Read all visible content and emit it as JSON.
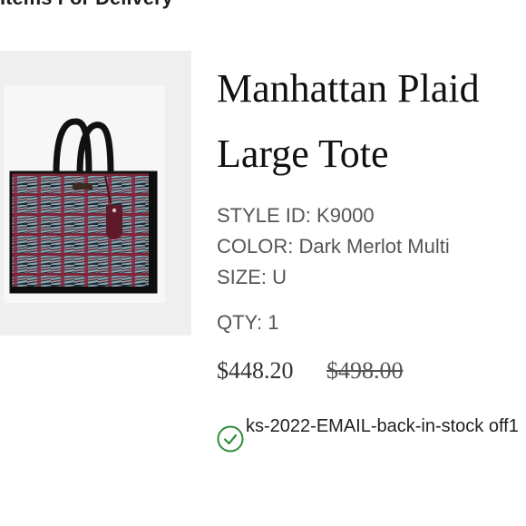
{
  "header": {
    "text": "Items For Delivery"
  },
  "product": {
    "title": "Manhattan Plaid Large Tote",
    "style_id": "STYLE ID: K9000",
    "color": "COLOR: Dark Merlot Multi",
    "size": "SIZE: U",
    "qty": "QTY: 1",
    "price_sale": "$448.20",
    "price_original": "$498.00"
  },
  "promo": {
    "code": "ks-2022-EMAIL-back-in-stock off1",
    "icon": "check-circle-icon",
    "icon_color": "#2e8b3a"
  },
  "colors": {
    "image_bg": "#efefef",
    "text_dark": "#111111",
    "text_muted": "#555555"
  }
}
